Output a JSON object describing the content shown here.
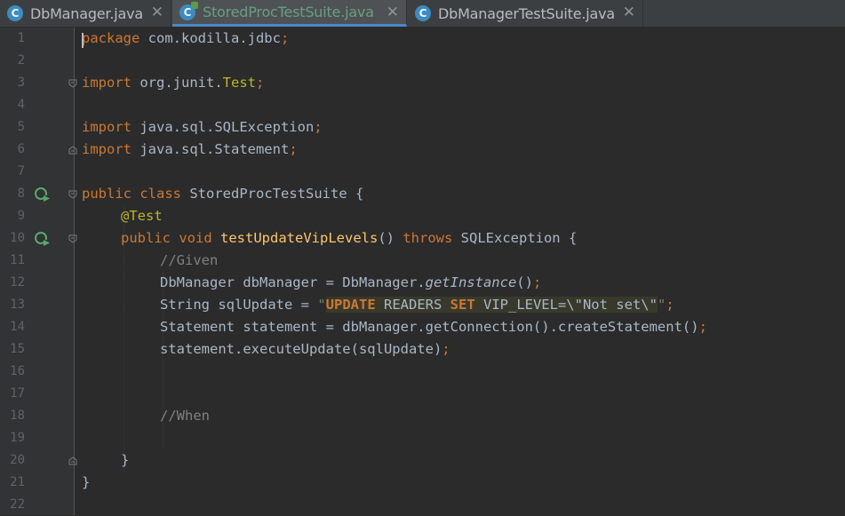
{
  "tabs": [
    {
      "label": "DbManager.java",
      "icon": "class-icon"
    },
    {
      "label": "StoredProcTestSuite.java",
      "icon": "test-class-icon"
    },
    {
      "label": "DbManagerTestSuite.java",
      "icon": "class-icon"
    }
  ],
  "close_glyph": "✕",
  "line_numbers": [
    "1",
    "2",
    "3",
    "4",
    "5",
    "6",
    "7",
    "8",
    "9",
    "10",
    "11",
    "12",
    "13",
    "14",
    "15",
    "16",
    "17",
    "18",
    "19",
    "20",
    "21",
    "22"
  ],
  "code": {
    "l1": {
      "kw": "package",
      "rest": " com.kodilla.jdbc",
      "semi": ";"
    },
    "l3": {
      "kw": "import",
      "path": " org.junit.",
      "cls": "Test",
      "semi": ";"
    },
    "l5": {
      "kw": "import",
      "rest": " java.sql.SQLException",
      "semi": ";"
    },
    "l6": {
      "kw": "import",
      "rest": " java.sql.Statement",
      "semi": ";"
    },
    "l8": {
      "kw1": "public",
      "kw2": "class",
      "rest": " StoredProcTestSuite {"
    },
    "l9": {
      "ann": "@Test"
    },
    "l10": {
      "kw1": "public",
      "kw2": "void",
      "fn": "testUpdateVipLevels",
      "p": "() ",
      "kw3": "throws",
      "rest": " SQLException {"
    },
    "l11": {
      "cm": "//Given"
    },
    "l12": {
      "a": "DbManager dbManager = DbManager.",
      "it": "getInstance",
      "b": "()",
      "semi": ";"
    },
    "l13": {
      "a": "String sqlUpdate = ",
      "q1": "\"",
      "k1": "UPDATE",
      "t1": " READERS ",
      "k2": "SET",
      "t2": " VIP_LEVEL=\\\"Not set\\\"",
      "q2": "\"",
      "semi": ";"
    },
    "l14": {
      "a": "Statement statement = dbManager.getConnection().createStatement()",
      "semi": ";"
    },
    "l15": {
      "a": "statement.executeUpdate(sqlUpdate)",
      "semi": ";"
    },
    "l18": {
      "cm": "//When"
    },
    "l20": {
      "a": "}"
    },
    "l21": {
      "a": "}"
    }
  }
}
